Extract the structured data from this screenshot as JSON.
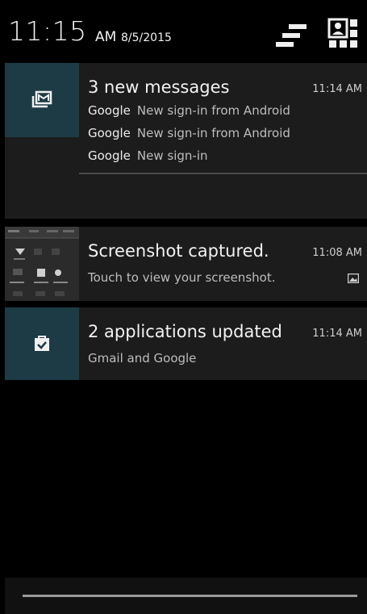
{
  "header": {
    "time": "11:15",
    "ampm": "AM",
    "date": "8/5/2015",
    "clear_icon": "clear-all-icon",
    "settings_icon": "quick-settings-icon"
  },
  "notifications": [
    {
      "icon": "gmail-icon",
      "title": "3 new messages",
      "time": "11:14 AM",
      "lines": [
        {
          "sender": "Google",
          "text": "New sign-in from Android"
        },
        {
          "sender": "Google",
          "text": "New sign-in from Android"
        },
        {
          "sender": "Google",
          "text": "New sign-in"
        }
      ]
    },
    {
      "icon": "screenshot-thumbnail",
      "title": "Screenshot captured.",
      "time": "11:08 AM",
      "subtitle": "Touch to view your screenshot.",
      "badge_icon": "image-icon"
    },
    {
      "icon": "play-store-bag-icon",
      "title": "2 applications updated",
      "time": "11:14 AM",
      "subtitle": "Gmail and Google"
    }
  ],
  "colors": {
    "icon_bg": "#1d3b45",
    "card_bg": "#1c1c1c"
  }
}
